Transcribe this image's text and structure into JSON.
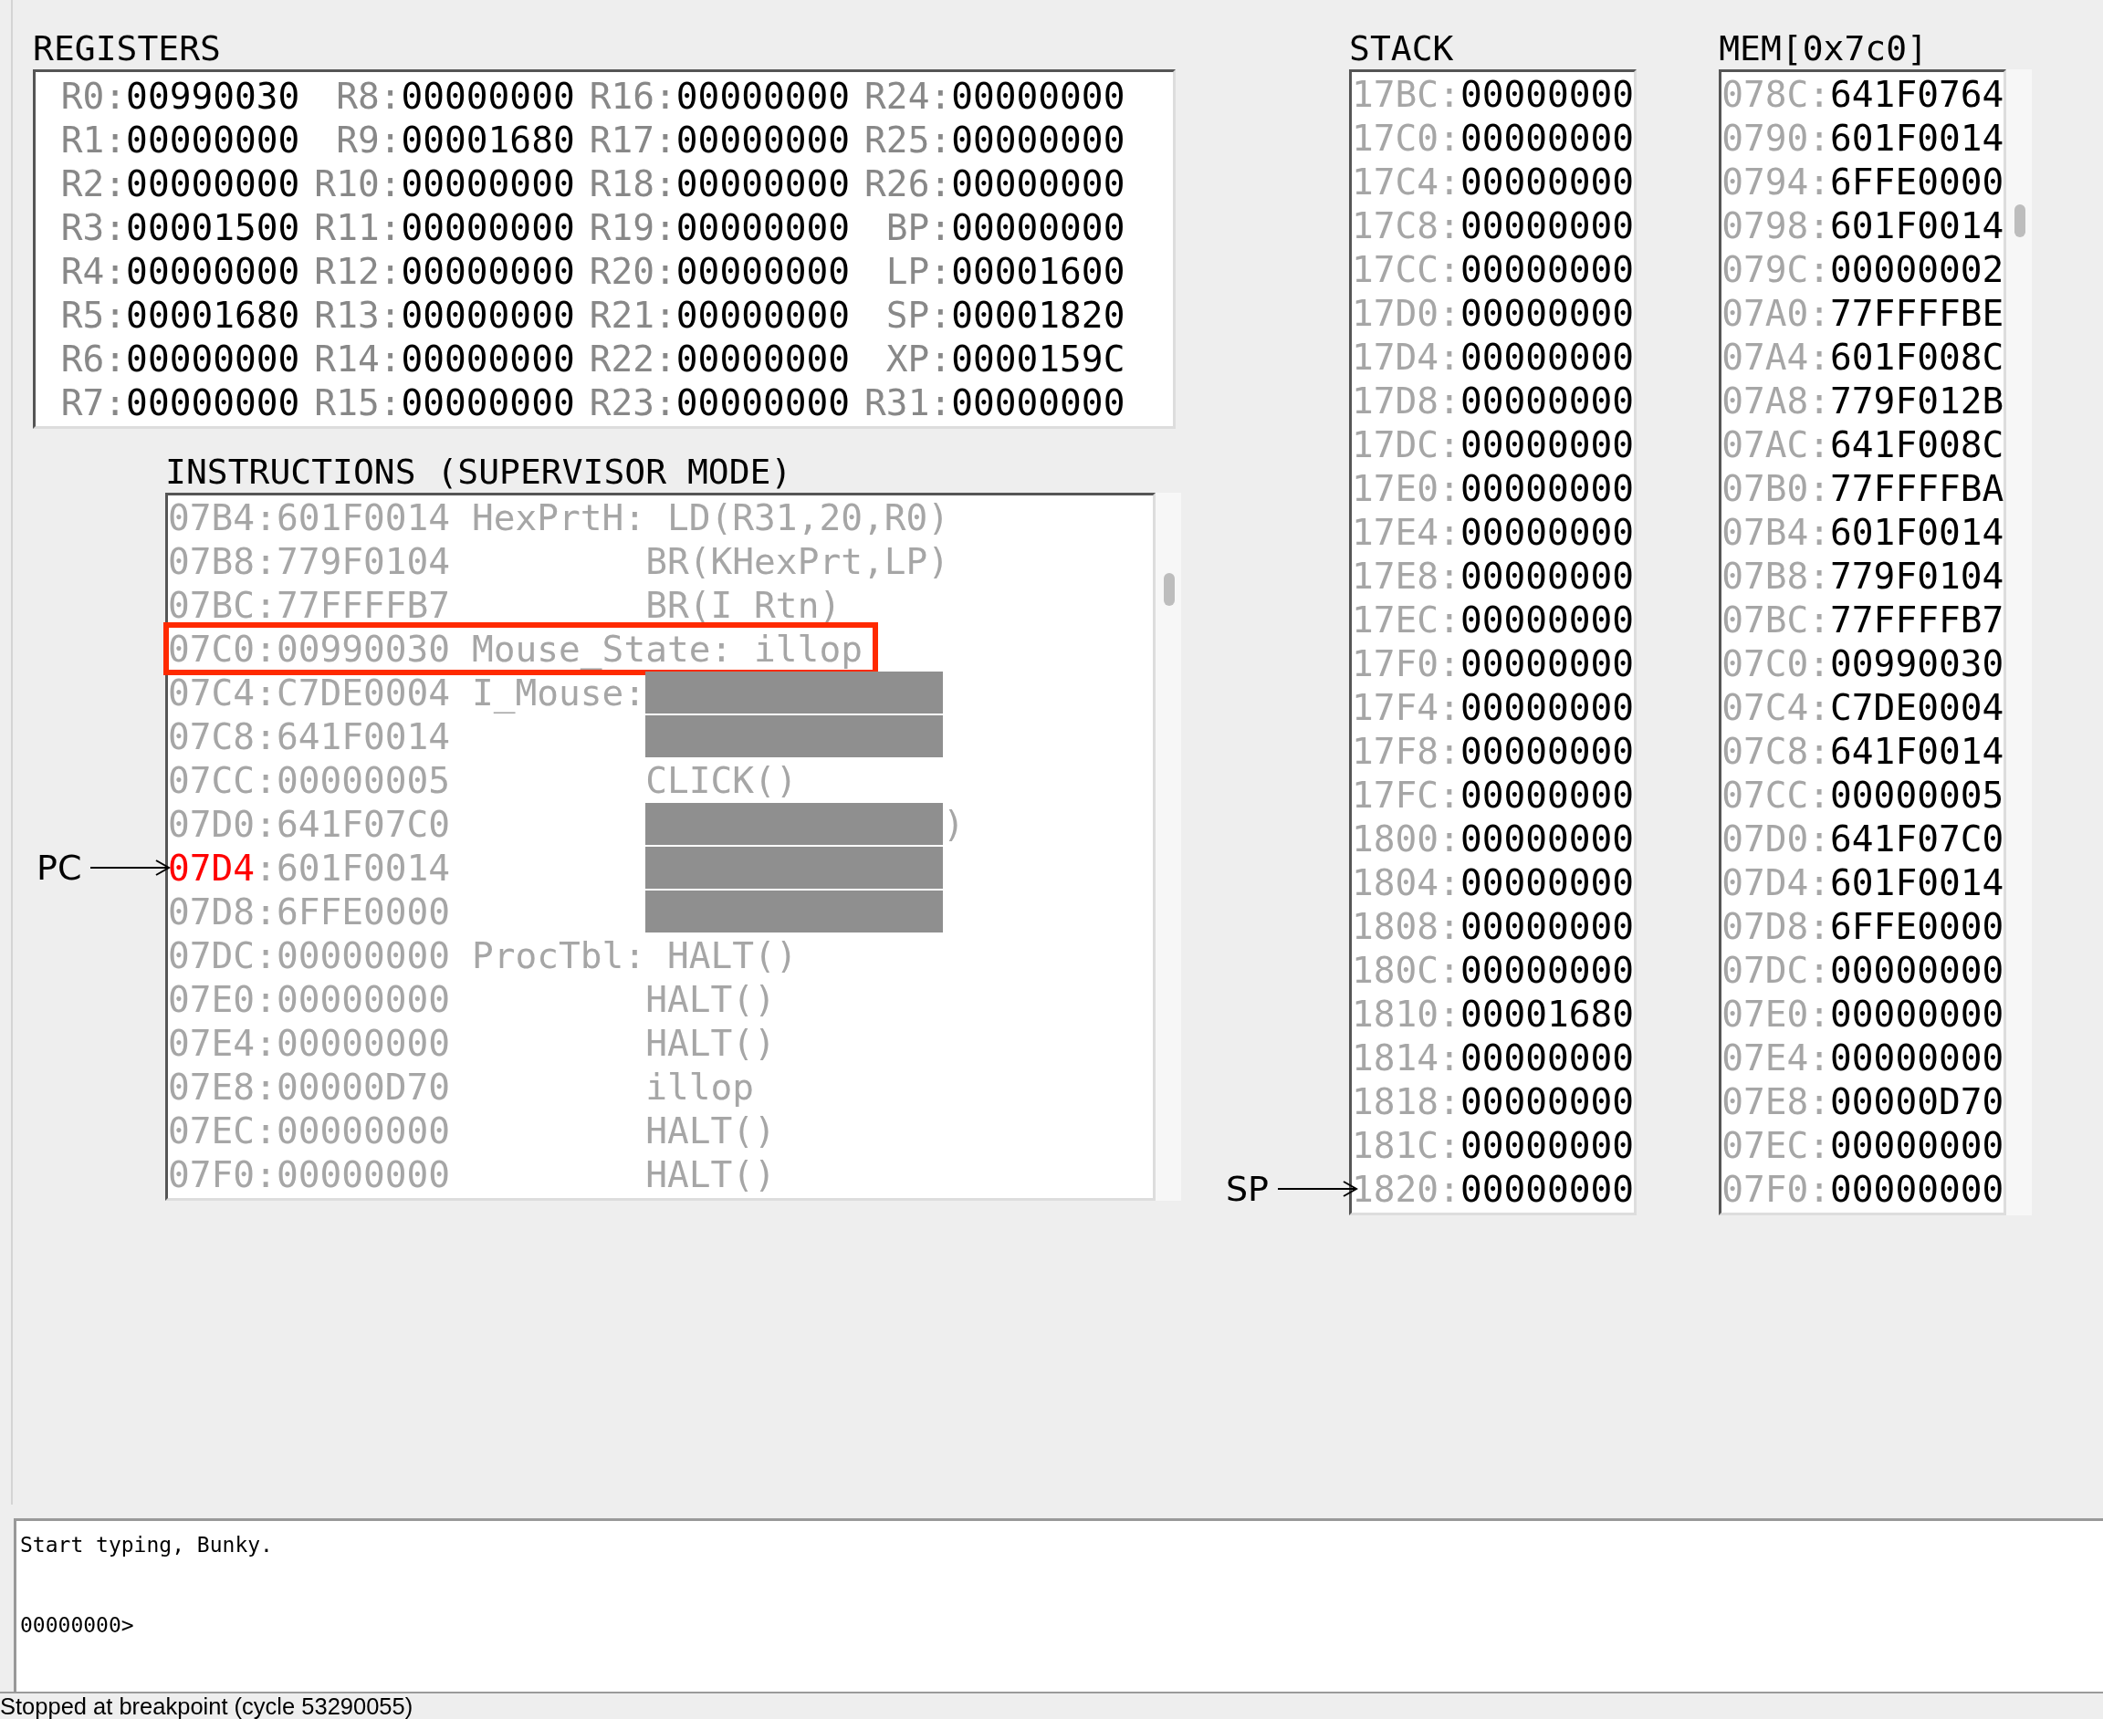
{
  "registers": {
    "title": "REGISTERS",
    "cells": [
      {
        "name": "R0:",
        "value": "00990030"
      },
      {
        "name": "R8:",
        "value": "00000000"
      },
      {
        "name": "R16:",
        "value": "00000000"
      },
      {
        "name": "R24:",
        "value": "00000000"
      },
      {
        "name": "R1:",
        "value": "00000000"
      },
      {
        "name": "R9:",
        "value": "00001680"
      },
      {
        "name": "R17:",
        "value": "00000000"
      },
      {
        "name": "R25:",
        "value": "00000000"
      },
      {
        "name": "R2:",
        "value": "00000000"
      },
      {
        "name": "R10:",
        "value": "00000000"
      },
      {
        "name": "R18:",
        "value": "00000000"
      },
      {
        "name": "R26:",
        "value": "00000000"
      },
      {
        "name": "R3:",
        "value": "00001500"
      },
      {
        "name": "R11:",
        "value": "00000000"
      },
      {
        "name": "R19:",
        "value": "00000000"
      },
      {
        "name": "BP:",
        "value": "00000000"
      },
      {
        "name": "R4:",
        "value": "00000000"
      },
      {
        "name": "R12:",
        "value": "00000000"
      },
      {
        "name": "R20:",
        "value": "00000000"
      },
      {
        "name": "LP:",
        "value": "00001600"
      },
      {
        "name": "R5:",
        "value": "00001680"
      },
      {
        "name": "R13:",
        "value": "00000000"
      },
      {
        "name": "R21:",
        "value": "00000000"
      },
      {
        "name": "SP:",
        "value": "00001820"
      },
      {
        "name": "R6:",
        "value": "00000000"
      },
      {
        "name": "R14:",
        "value": "00000000"
      },
      {
        "name": "R22:",
        "value": "00000000"
      },
      {
        "name": "XP:",
        "value": "0000159C"
      },
      {
        "name": "R7:",
        "value": "00000000"
      },
      {
        "name": "R15:",
        "value": "00000000"
      },
      {
        "name": "R23:",
        "value": "00000000"
      },
      {
        "name": "R31:",
        "value": "00000000"
      }
    ]
  },
  "instructions": {
    "title": "INSTRUCTIONS (SUPERVISOR MODE)",
    "pointer_label": "PC",
    "rows": [
      {
        "address": "07B4",
        "word": ":601F0014",
        "label": "HexPrtH:",
        "operand": "LD(R31,20,R0)",
        "pc": false,
        "highlighted": false,
        "redacted": false
      },
      {
        "address": "07B8",
        "word": ":779F0104",
        "operand": "BR(KHexPrt,LP)",
        "pc": false,
        "highlighted": false,
        "redacted": false
      },
      {
        "address": "07BC",
        "word": ":77FFFFB7",
        "operand": "BR(I_Rtn)",
        "pc": false,
        "highlighted": false,
        "redacted": false
      },
      {
        "address": "07C0",
        "word": ":00990030",
        "label": "Mouse_State:",
        "operand": "illop",
        "pc": false,
        "highlighted": true,
        "redacted": false
      },
      {
        "address": "07C4",
        "word": ":C7DE0004",
        "label": "I_Mouse:",
        "pc": false,
        "highlighted": false,
        "redacted": true
      },
      {
        "address": "07C8",
        "word": ":641F0014",
        "pc": false,
        "highlighted": false,
        "redacted": true
      },
      {
        "address": "07CC",
        "word": ":00000005",
        "operand": "CLICK()",
        "pc": false,
        "highlighted": false,
        "redacted": false
      },
      {
        "address": "07D0",
        "word": ":641F07C0",
        "tail": ")",
        "pc": false,
        "highlighted": false,
        "redacted": true
      },
      {
        "address": "07D4",
        "word": ":601F0014",
        "pc": true,
        "highlighted": false,
        "redacted": true
      },
      {
        "address": "07D8",
        "word": ":6FFE0000",
        "pc": false,
        "highlighted": false,
        "redacted": true
      },
      {
        "address": "07DC",
        "word": ":00000000",
        "label": "ProcTbl:",
        "operand": "HALT()",
        "pc": false,
        "highlighted": false,
        "redacted": false
      },
      {
        "address": "07E0",
        "word": ":00000000",
        "operand": "HALT()",
        "pc": false,
        "highlighted": false,
        "redacted": false
      },
      {
        "address": "07E4",
        "word": ":00000000",
        "operand": "HALT()",
        "pc": false,
        "highlighted": false,
        "redacted": false
      },
      {
        "address": "07E8",
        "word": ":00000D70",
        "operand": "illop",
        "pc": false,
        "highlighted": false,
        "redacted": false
      },
      {
        "address": "07EC",
        "word": ":00000000",
        "operand": "HALT()",
        "pc": false,
        "highlighted": false,
        "redacted": false
      },
      {
        "address": "07F0",
        "word": ":00000000",
        "operand": "HALT()",
        "pc": false,
        "highlighted": false,
        "redacted": false
      }
    ]
  },
  "stack": {
    "title": "STACK",
    "pointer_label": "SP",
    "rows": [
      {
        "address": "17BC:",
        "value": "00000000",
        "sp": false
      },
      {
        "address": "17C0:",
        "value": "00000000",
        "sp": false
      },
      {
        "address": "17C4:",
        "value": "00000000",
        "sp": false
      },
      {
        "address": "17C8:",
        "value": "00000000",
        "sp": false
      },
      {
        "address": "17CC:",
        "value": "00000000",
        "sp": false
      },
      {
        "address": "17D0:",
        "value": "00000000",
        "sp": false
      },
      {
        "address": "17D4:",
        "value": "00000000",
        "sp": false
      },
      {
        "address": "17D8:",
        "value": "00000000",
        "sp": false
      },
      {
        "address": "17DC:",
        "value": "00000000",
        "sp": false
      },
      {
        "address": "17E0:",
        "value": "00000000",
        "sp": false
      },
      {
        "address": "17E4:",
        "value": "00000000",
        "sp": false
      },
      {
        "address": "17E8:",
        "value": "00000000",
        "sp": false
      },
      {
        "address": "17EC:",
        "value": "00000000",
        "sp": false
      },
      {
        "address": "17F0:",
        "value": "00000000",
        "sp": false
      },
      {
        "address": "17F4:",
        "value": "00000000",
        "sp": false
      },
      {
        "address": "17F8:",
        "value": "00000000",
        "sp": false
      },
      {
        "address": "17FC:",
        "value": "00000000",
        "sp": false
      },
      {
        "address": "1800:",
        "value": "00000000",
        "sp": false
      },
      {
        "address": "1804:",
        "value": "00000000",
        "sp": false
      },
      {
        "address": "1808:",
        "value": "00000000",
        "sp": false
      },
      {
        "address": "180C:",
        "value": "00000000",
        "sp": false
      },
      {
        "address": "1810:",
        "value": "00001680",
        "sp": false
      },
      {
        "address": "1814:",
        "value": "00000000",
        "sp": false
      },
      {
        "address": "1818:",
        "value": "00000000",
        "sp": false
      },
      {
        "address": "181C:",
        "value": "00000000",
        "sp": false
      },
      {
        "address": "1820:",
        "value": "00000000",
        "sp": true
      }
    ]
  },
  "memory": {
    "title": "MEM[0x7c0]",
    "rows": [
      {
        "address": "078C:",
        "value": "641F0764"
      },
      {
        "address": "0790:",
        "value": "601F0014"
      },
      {
        "address": "0794:",
        "value": "6FFE0000"
      },
      {
        "address": "0798:",
        "value": "601F0014"
      },
      {
        "address": "079C:",
        "value": "00000002"
      },
      {
        "address": "07A0:",
        "value": "77FFFFBE"
      },
      {
        "address": "07A4:",
        "value": "601F008C"
      },
      {
        "address": "07A8:",
        "value": "779F012B"
      },
      {
        "address": "07AC:",
        "value": "641F008C"
      },
      {
        "address": "07B0:",
        "value": "77FFFFBA"
      },
      {
        "address": "07B4:",
        "value": "601F0014"
      },
      {
        "address": "07B8:",
        "value": "779F0104"
      },
      {
        "address": "07BC:",
        "value": "77FFFFB7"
      },
      {
        "address": "07C0:",
        "value": "00990030"
      },
      {
        "address": "07C4:",
        "value": "C7DE0004"
      },
      {
        "address": "07C8:",
        "value": "641F0014"
      },
      {
        "address": "07CC:",
        "value": "00000005"
      },
      {
        "address": "07D0:",
        "value": "641F07C0"
      },
      {
        "address": "07D4:",
        "value": "601F0014"
      },
      {
        "address": "07D8:",
        "value": "6FFE0000"
      },
      {
        "address": "07DC:",
        "value": "00000000"
      },
      {
        "address": "07E0:",
        "value": "00000000"
      },
      {
        "address": "07E4:",
        "value": "00000000"
      },
      {
        "address": "07E8:",
        "value": "00000D70"
      },
      {
        "address": "07EC:",
        "value": "00000000"
      },
      {
        "address": "07F0:",
        "value": "00000000"
      }
    ]
  },
  "console": {
    "message": "Start typing, Bunky.",
    "prompt": "00000000>"
  },
  "status_bar": "Stopped at breakpoint (cycle 53290055)"
}
